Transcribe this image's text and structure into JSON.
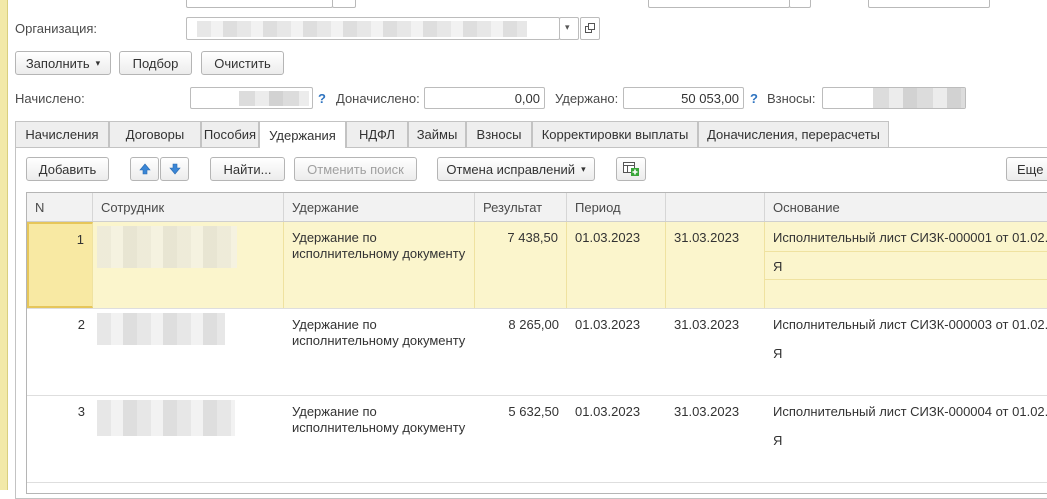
{
  "form": {
    "org_label": "Организация:",
    "fill_btn": "Заполнить",
    "pick_btn": "Подбор",
    "clear_btn": "Очистить",
    "accrued_label": "Начислено:",
    "additional_label": "Доначислено:",
    "additional_value": "0,00",
    "withheld_label": "Удержано:",
    "withheld_value": "50 053,00",
    "contrib_label": "Взносы:",
    "help_mark": "?"
  },
  "tabs": [
    {
      "label": "Начисления"
    },
    {
      "label": "Договоры"
    },
    {
      "label": "Пособия"
    },
    {
      "label": "Удержания"
    },
    {
      "label": "НДФЛ"
    },
    {
      "label": "Займы"
    },
    {
      "label": "Взносы"
    },
    {
      "label": "Корректировки выплаты"
    },
    {
      "label": "Доначисления, перерасчеты"
    }
  ],
  "toolbar": {
    "add_btn": "Добавить",
    "find_btn": "Найти...",
    "cancel_search_btn": "Отменить поиск",
    "undo_corrections_btn": "Отмена исправлений",
    "more_btn": "Еще"
  },
  "table": {
    "columns": [
      "N",
      "Сотрудник",
      "Удержание",
      "Результат",
      "Период",
      "",
      "Основание"
    ],
    "rows": [
      {
        "n": "1",
        "deduction": "Удержание по исполнительному документу",
        "result": "7 438,50",
        "start": "01.03.2023",
        "end": "31.03.2023",
        "basis": "Исполнительный лист СИЗК-000001 от 01.02...",
        "basis2": "Я"
      },
      {
        "n": "2",
        "deduction": "Удержание по исполнительному документу",
        "result": "8 265,00",
        "start": "01.03.2023",
        "end": "31.03.2023",
        "basis": "Исполнительный лист СИЗК-000003 от 01.02...",
        "basis2": "Я"
      },
      {
        "n": "3",
        "deduction": "Удержание по исполнительному документу",
        "result": "5 632,50",
        "start": "01.03.2023",
        "end": "31.03.2023",
        "basis": "Исполнительный лист СИЗК-000004 от 01.02...",
        "basis2": "Я"
      }
    ]
  },
  "colors": {
    "accent_blue": "#2f74c0",
    "selected_row": "#fbf5cc",
    "selected_cell_border": "#e6c65a"
  }
}
